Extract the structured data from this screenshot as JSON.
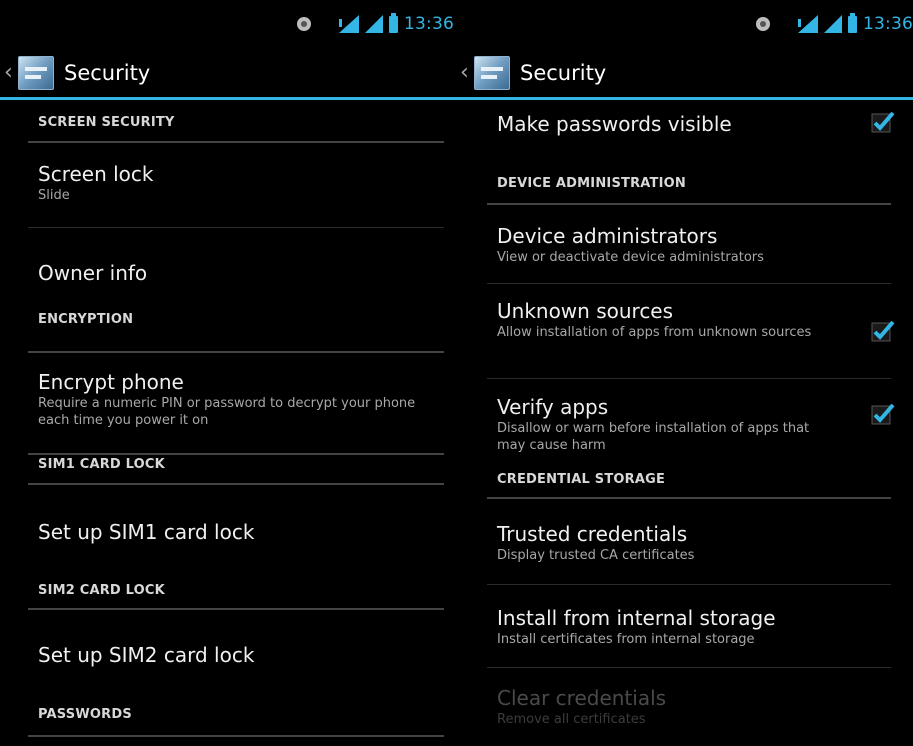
{
  "status_bar": {
    "time": "13:36"
  },
  "action_bar": {
    "title": "Security"
  },
  "left_screen": {
    "sections": [
      {
        "header": "SCREEN SECURITY",
        "items": [
          {
            "title": "Screen lock",
            "summary": "Slide"
          },
          {
            "title": "Owner info",
            "summary": ""
          }
        ]
      },
      {
        "header": "ENCRYPTION",
        "items": [
          {
            "title": "Encrypt phone",
            "summary": "Require a numeric PIN or password to decrypt your phone each time you power it on"
          }
        ]
      },
      {
        "header": "SIM1 CARD LOCK",
        "items": [
          {
            "title": "Set up SIM1 card lock",
            "summary": ""
          }
        ]
      },
      {
        "header": "SIM2 CARD LOCK",
        "items": [
          {
            "title": "Set up SIM2 card lock",
            "summary": ""
          }
        ]
      },
      {
        "header": "PASSWORDS",
        "items": []
      }
    ]
  },
  "right_screen": {
    "items_top": [
      {
        "title": "Make passwords visible",
        "checked": true
      }
    ],
    "sections": [
      {
        "header": "DEVICE ADMINISTRATION",
        "items": [
          {
            "title": "Device administrators",
            "summary": "View or deactivate device administrators",
            "checkbox": false
          },
          {
            "title": "Unknown sources",
            "summary": "Allow installation of apps from unknown sources",
            "checkbox": true,
            "checked": true
          },
          {
            "title": "Verify apps",
            "summary": "Disallow or warn before installation of apps that may cause harm",
            "checkbox": true,
            "checked": true
          }
        ]
      },
      {
        "header": "CREDENTIAL STORAGE",
        "items": [
          {
            "title": "Trusted credentials",
            "summary": "Display trusted CA certificates",
            "enabled": true
          },
          {
            "title": "Install from internal storage",
            "summary": "Install certificates from internal storage",
            "enabled": true
          },
          {
            "title": "Clear credentials",
            "summary": "Remove all certificates",
            "enabled": false
          }
        ]
      }
    ]
  },
  "colors": {
    "accent": "#33b5e5",
    "background": "#000000",
    "divider": "#444444"
  }
}
